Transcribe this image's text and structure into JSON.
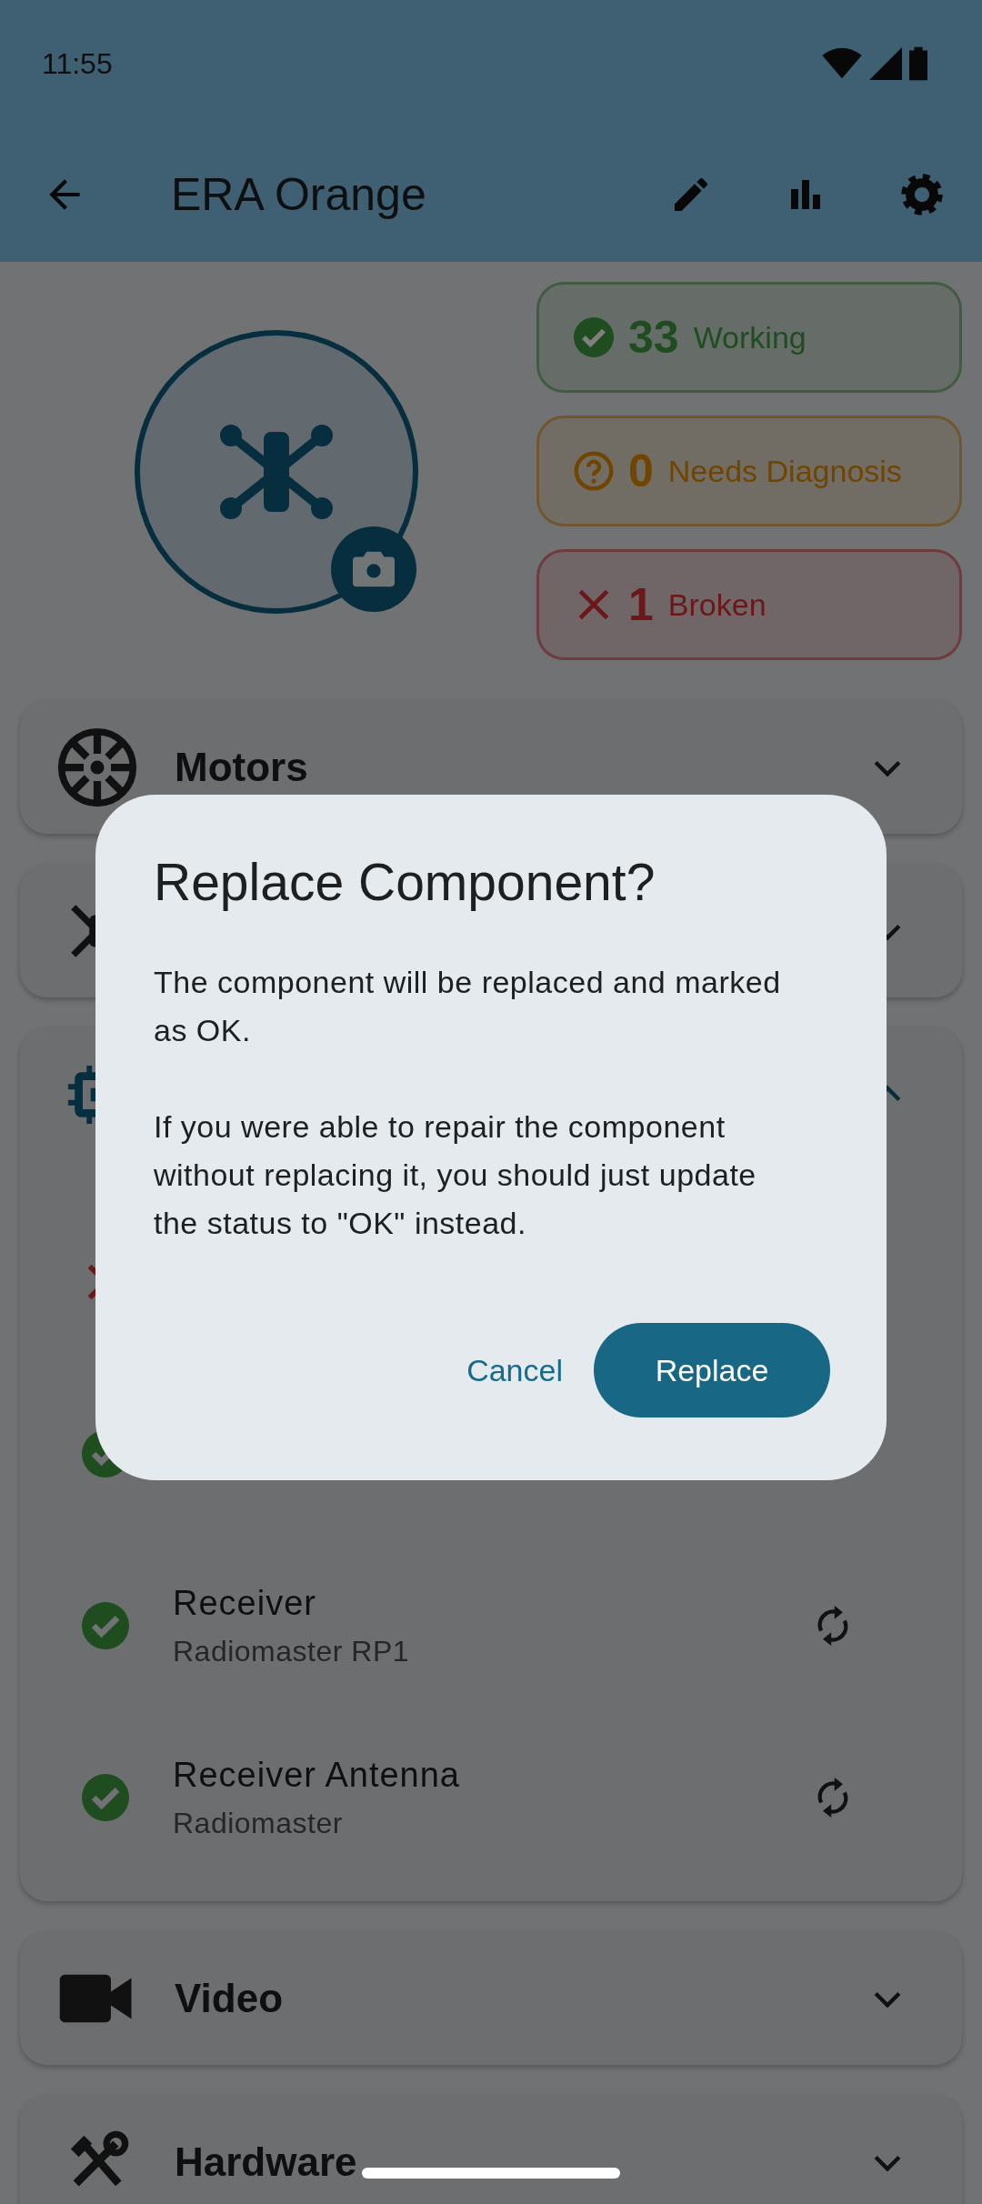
{
  "status_bar": {
    "time": "11:55"
  },
  "app_bar": {
    "title": "ERA Orange"
  },
  "stats": [
    {
      "kind": "working",
      "count": "33",
      "label": "Working"
    },
    {
      "kind": "diagnosis",
      "count": "0",
      "label": "Needs Diagnosis"
    },
    {
      "kind": "broken",
      "count": "1",
      "label": "Broken"
    }
  ],
  "sections": [
    {
      "kind": "motor",
      "title": "Motors",
      "expanded": false
    },
    {
      "kind": "frame",
      "expanded": false
    },
    {
      "kind": "chip",
      "expanded": true,
      "items": [
        {
          "kind": "broken"
        },
        {
          "kind": "ok"
        },
        {
          "kind": "ok",
          "title": "Receiver",
          "subtitle": "Radiomaster RP1"
        },
        {
          "kind": "ok",
          "title": "Receiver Antenna",
          "subtitle": "Radiomaster"
        }
      ]
    },
    {
      "kind": "video",
      "title": "Video",
      "expanded": false
    },
    {
      "kind": "tools",
      "title": "Hardware",
      "expanded": false
    }
  ],
  "dialog": {
    "title": "Replace Component?",
    "paragraphs": [
      "The component will be replaced and marked as OK.",
      "If you were able to repair the component without replacing it, you should just update the status to \"OK\" instead."
    ],
    "buttons": [
      {
        "kind": "text",
        "label": "Cancel"
      },
      {
        "kind": "filled",
        "label": "Replace"
      }
    ]
  }
}
